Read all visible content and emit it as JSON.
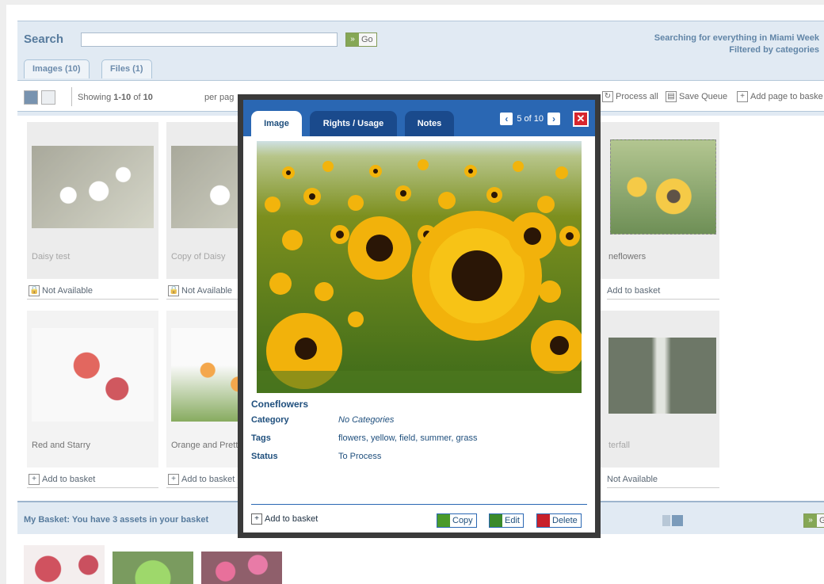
{
  "search": {
    "label": "Search",
    "input_value": "",
    "go_label": "Go",
    "info_line1": "Searching for everything in Miami Week",
    "info_line2": "Filtered by categories"
  },
  "tabs": [
    {
      "label": "Images (10)"
    },
    {
      "label": "Files (1)"
    }
  ],
  "toolbar": {
    "showing_prefix": "Showing ",
    "showing_range": "1-10",
    "showing_of": " of ",
    "showing_total": "10",
    "per_page": "per pag",
    "process_all": "Process all",
    "save_queue": "Save Queue",
    "add_page": "Add page to baske"
  },
  "cards": [
    {
      "name": "Daisy test",
      "action": "Not Available"
    },
    {
      "name": "Copy of Daisy",
      "action": "Not Available"
    },
    {
      "name": "neflowers",
      "action": "Add to basket"
    },
    {
      "name": "Red and Starry",
      "action": "Add to basket"
    },
    {
      "name": "Orange and Prett",
      "action": "Add to basket"
    },
    {
      "name": "terfall",
      "action": "Not Available"
    }
  ],
  "basket": {
    "title": "My Basket: You have 3 assets in your basket",
    "go_label": "Go"
  },
  "modal": {
    "tabs": [
      {
        "label": "Image"
      },
      {
        "label": "Rights / Usage"
      },
      {
        "label": "Notes"
      }
    ],
    "pager": "5 of 10",
    "close_glyph": "✕",
    "asset_name": "Coneflowers",
    "meta": [
      {
        "key": "Category",
        "value": "No Categories"
      },
      {
        "key": "Tags",
        "value": "flowers, yellow, field, summer, grass"
      },
      {
        "key": "Status",
        "value": "To Process"
      }
    ],
    "footer": {
      "add_to_basket": "Add to basket",
      "copy": "Copy",
      "edit": "Edit",
      "delete": "Delete"
    }
  },
  "colors": {
    "accent": "#2a67b3",
    "bar": "#d7e3ef",
    "go_green": "#5c8a1c",
    "close_red": "#d8262d"
  },
  "icons": [
    "grid-view-icon",
    "list-view-icon",
    "lock-icon",
    "plus-icon",
    "arrow-left-icon",
    "arrow-right-icon",
    "close-icon",
    "copy-icon",
    "edit-icon",
    "trash-icon",
    "save-icon",
    "process-icon"
  ]
}
